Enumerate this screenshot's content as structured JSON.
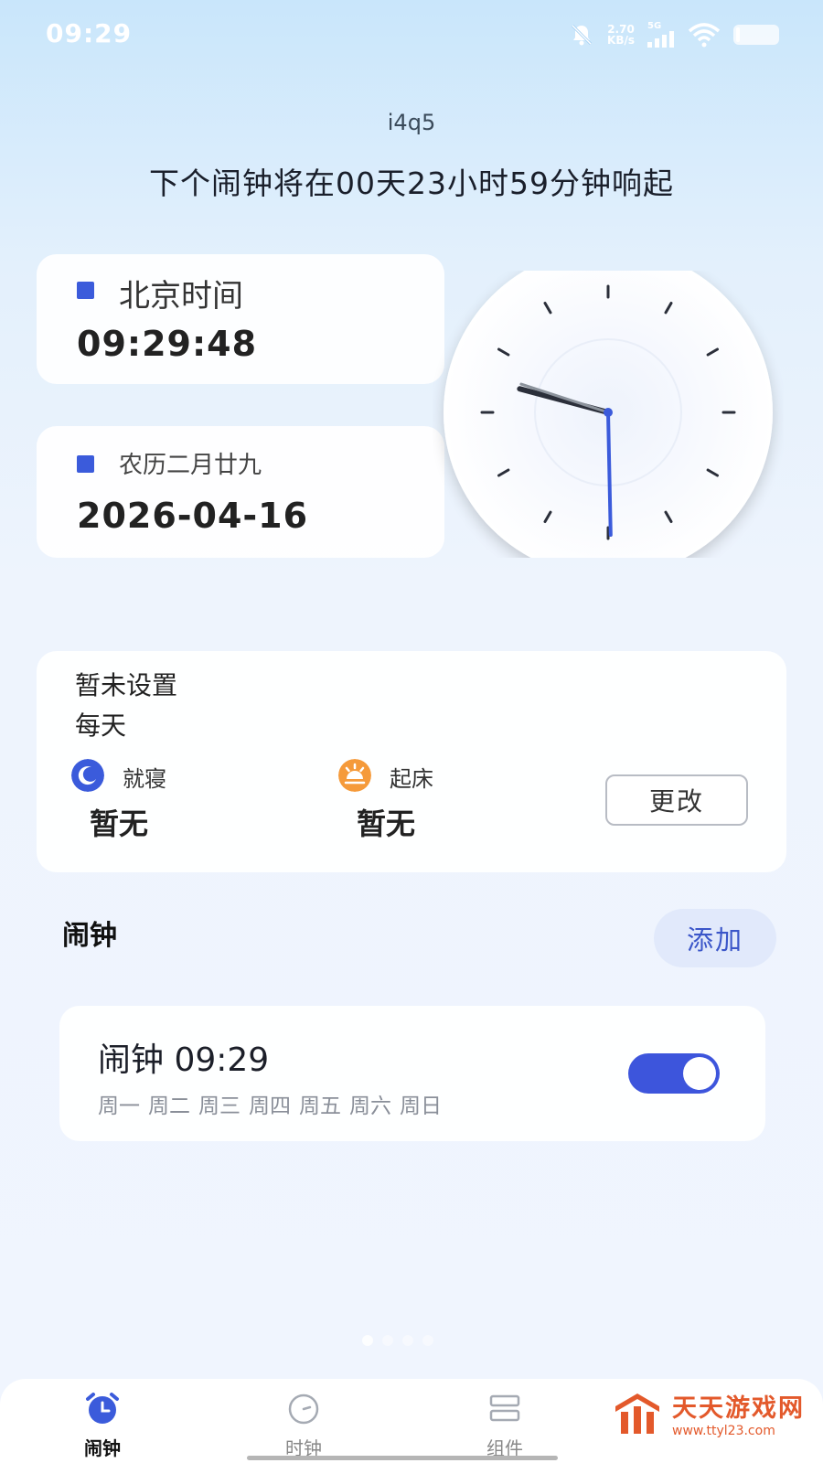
{
  "status_bar": {
    "time": "09:29",
    "net_speed_value": "2.70",
    "net_speed_unit": "KB/s",
    "network_type": "5G",
    "icons": [
      "bell-off-icon",
      "signal-icon",
      "wifi-icon",
      "battery-icon"
    ]
  },
  "header": {
    "device_name": "i4q5",
    "countdown": "下个闹钟将在00天23小时59分钟响起"
  },
  "beijing_time": {
    "title": "北京时间",
    "value": "09:29:48"
  },
  "date_info": {
    "lunar": "农历二月廿九",
    "date": "2026-04-16"
  },
  "analog_clock": {
    "hour": 9,
    "minute": 29,
    "second": 48,
    "hour_hand_color": "#2b2f3a",
    "minute_hand_color": "#3b5bdb",
    "second_hand_color": "#8c939c"
  },
  "sleep_schedule": {
    "status": "暂未设置",
    "repeat": "每天",
    "bedtime_label": "就寝",
    "bedtime_value": "暂无",
    "wakeup_label": "起床",
    "wakeup_value": "暂无",
    "change_button": "更改"
  },
  "alarms": {
    "header": "闹钟",
    "add_button": "添加",
    "items": [
      {
        "title": "闹钟 09:29",
        "days": [
          "周一",
          "周二",
          "周三",
          "周四",
          "周五",
          "周六",
          "周日"
        ],
        "enabled": true
      }
    ]
  },
  "tabs": [
    {
      "label": "闹钟",
      "icon": "alarm-clock-icon",
      "active": true
    },
    {
      "label": "时钟",
      "icon": "clock-icon",
      "active": false
    },
    {
      "label": "组件",
      "icon": "widgets-icon",
      "active": false
    }
  ],
  "watermark": {
    "title": "天天游戏网",
    "url": "www.ttyl23.com"
  },
  "colors": {
    "accent": "#3b5bdb",
    "sun_icon": "#f59a3a"
  }
}
